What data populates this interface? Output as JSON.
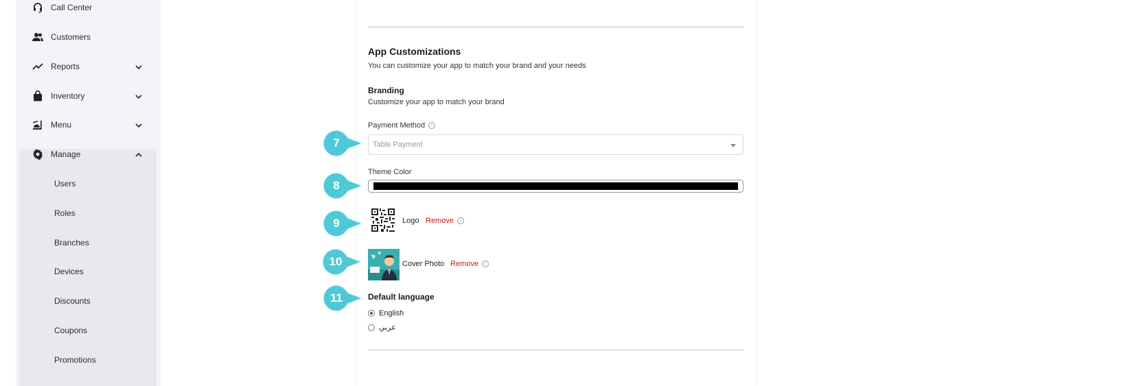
{
  "sidebar": {
    "items": [
      {
        "label": "Call Center",
        "icon": "headset-icon"
      },
      {
        "label": "Customers",
        "icon": "people-icon"
      },
      {
        "label": "Reports",
        "icon": "trend-icon",
        "expandable": true
      },
      {
        "label": "Inventory",
        "icon": "bag-icon",
        "expandable": true
      },
      {
        "label": "Menu",
        "icon": "food-icon",
        "expandable": true
      },
      {
        "label": "Manage",
        "icon": "gear-icon",
        "expanded": true
      }
    ],
    "manage_sub": [
      "Users",
      "Roles",
      "Branches",
      "Devices",
      "Discounts",
      "Coupons",
      "Promotions"
    ]
  },
  "main": {
    "section_title": "App Customizations",
    "section_desc": "You can customize your app to match your brand and your needs",
    "branding_title": "Branding",
    "branding_desc": "Customize your app to match your brand",
    "payment_method_label": "Payment Method",
    "payment_method_value": "Table Payment",
    "theme_color_label": "Theme Color",
    "theme_color_value": "#000000",
    "logo_label": "Logo",
    "logo_remove": "Remove",
    "cover_label": "Cover Photo",
    "cover_remove": "Remove",
    "language_title": "Default language",
    "languages": [
      {
        "label": "English",
        "checked": true
      },
      {
        "label": "عربي",
        "checked": false
      }
    ]
  },
  "markers": [
    "7",
    "8",
    "9",
    "10",
    "11"
  ],
  "colors": {
    "accent_marker": "#4fc9d6",
    "remove_link": "#c0161c",
    "sidebar_bg": "#f4f3f8"
  }
}
